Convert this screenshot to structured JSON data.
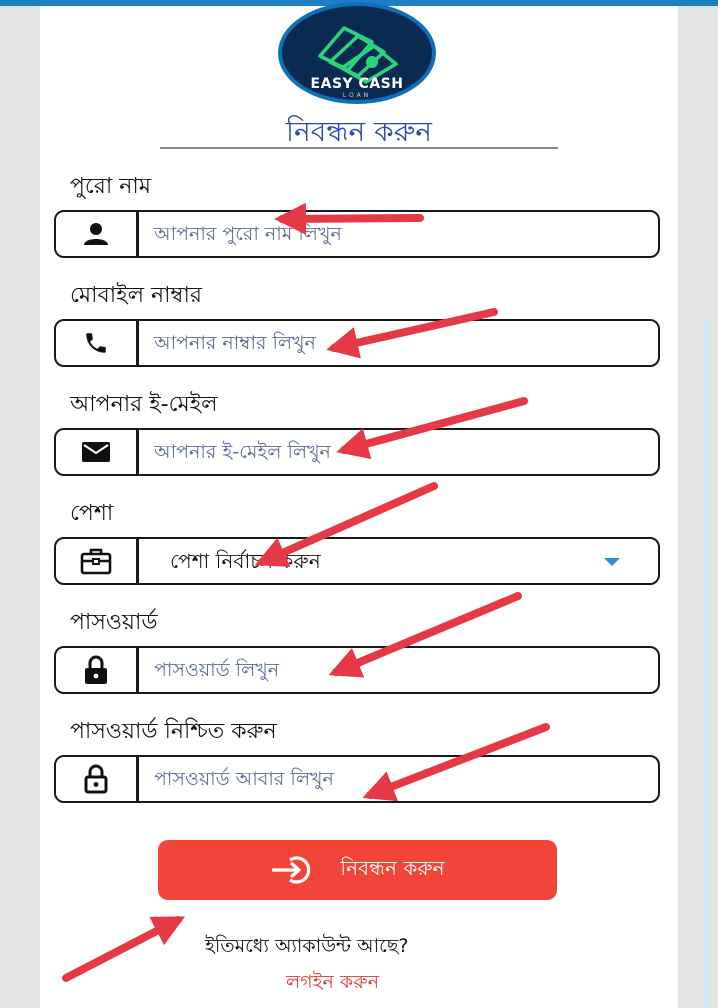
{
  "brand": {
    "name": "EASY CASH",
    "sub": "LOAN",
    "colors": {
      "navy": "#0b2a52",
      "ring": "#0e6fbb",
      "note": "#2bd47b"
    }
  },
  "title": "নিবন্ধন করুন",
  "fields": [
    {
      "label": "পুরো নাম",
      "placeholder": "আপনার পুরো নাম লিখুন",
      "icon": "person-icon"
    },
    {
      "label": "মোবাইল নাম্বার",
      "placeholder": "আপনার নাম্বার লিখুন",
      "icon": "phone-icon"
    },
    {
      "label": "আপনার ই-মেইল",
      "placeholder": "আপনার ই-মেইল লিখুন",
      "icon": "mail-icon"
    },
    {
      "label": "পেশা",
      "value": "পেশা নির্বাচন করুন",
      "icon": "briefcase-icon"
    },
    {
      "label": "পাসওয়ার্ড",
      "placeholder": "পাসওয়ার্ড লিখুন",
      "icon": "lock-icon"
    },
    {
      "label": "পাসওয়ার্ড নিশ্চিত করুন",
      "placeholder": "পাসওয়ার্ড আবার লিখুন",
      "icon": "lock-open-icon"
    }
  ],
  "submit": {
    "label": "নিবন্ধন করুন",
    "icon": "login-arrow-icon",
    "color": "#f2453a"
  },
  "footer": {
    "question": "ইতিমধ্যে অ্যাকাউন্ট আছে?",
    "login": "লগইন করুন",
    "login_color": "#e53935"
  },
  "annotation_color": "#e53945"
}
